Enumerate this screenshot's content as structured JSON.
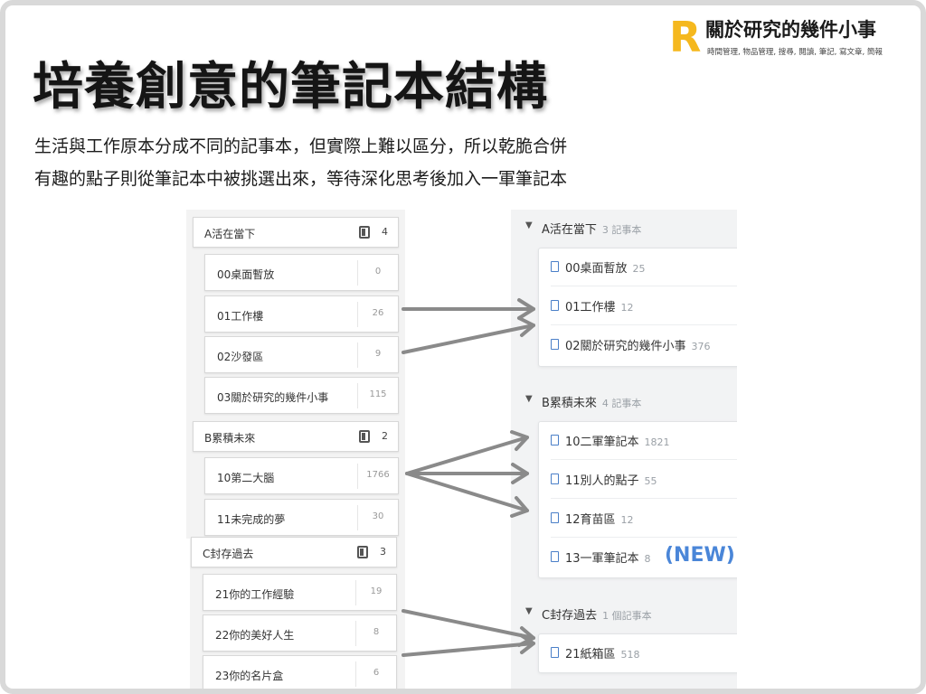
{
  "logo": {
    "mark": "R",
    "title": "關於研究的幾件小事",
    "subtitle": "時間管理, 物品管理, 搜尋, 閱讀, 筆記, 寫文章, 簡報"
  },
  "slide": {
    "title": "培養創意的筆記本結構",
    "line1": "生活與工作原本分成不同的記事本，但實際上難以區分，所以乾脆合併",
    "line2": "有趣的點子則從筆記本中被挑選出來，等待深化思考後加入一軍筆記本"
  },
  "old_structure": {
    "stacks": [
      {
        "name": "A活在當下",
        "count": "4",
        "notebooks": [
          {
            "name": "00桌面暫放",
            "count": "0"
          },
          {
            "name": "01工作樓",
            "count": "26"
          },
          {
            "name": "02沙發區",
            "count": "9"
          },
          {
            "name": "03關於研究的幾件小事",
            "count": "115"
          }
        ]
      },
      {
        "name": "B累積未來",
        "count": "2",
        "notebooks": [
          {
            "name": "10第二大腦",
            "count": "1766"
          },
          {
            "name": "11未完成的夢",
            "count": "30"
          }
        ]
      },
      {
        "name": "C封存過去",
        "count": "3",
        "notebooks": [
          {
            "name": "21你的工作經驗",
            "count": "19"
          },
          {
            "name": "22你的美好人生",
            "count": "8"
          },
          {
            "name": "23你的名片盒",
            "count": "6"
          }
        ]
      }
    ]
  },
  "new_structure": {
    "stacks": [
      {
        "name": "A活在當下",
        "sub": "3 記事本",
        "notebooks": [
          {
            "name": "00桌面暫放",
            "count": "25"
          },
          {
            "name": "01工作樓",
            "count": "12"
          },
          {
            "name": "02關於研究的幾件小事",
            "count": "376"
          }
        ]
      },
      {
        "name": "B累積未來",
        "sub": "4 記事本",
        "notebooks": [
          {
            "name": "10二軍筆記本",
            "count": "1821"
          },
          {
            "name": "11別人的點子",
            "count": "55"
          },
          {
            "name": "12育苗區",
            "count": "12"
          },
          {
            "name": "13一軍筆記本",
            "count": "8"
          }
        ]
      },
      {
        "name": "C封存過去",
        "sub": "1 個記事本",
        "notebooks": [
          {
            "name": "21紙箱區",
            "count": "518"
          }
        ]
      }
    ],
    "new_tag": "(NEW)"
  },
  "colors": {
    "logo_accent": "#f5b81e",
    "arrow": "#8a8a8a",
    "notebook_icon": "#4a7fc8",
    "new_tag": "#4a86d8"
  }
}
